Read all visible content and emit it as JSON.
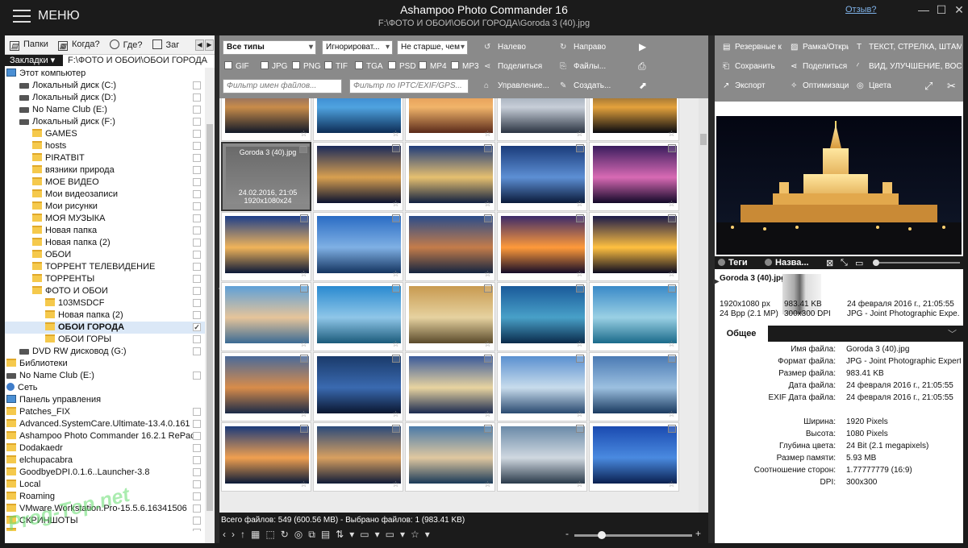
{
  "app": {
    "menu_label": "МЕНЮ",
    "title": "Ashampoo Photo Commander 16",
    "path": "F:\\ФОТО И ОБОИ\\ОБОИ ГОРОДА\\Goroda 3  (40).jpg",
    "help": "Отзыв?"
  },
  "nav": {
    "folders": "Папки",
    "when": "Когда?",
    "where": "Где?",
    "more": "Заг"
  },
  "bookmarks": {
    "label": "Закладки",
    "path": "F:\\ФОТО И ОБОИ\\ОБОИ ГОРОДА"
  },
  "tree": [
    {
      "label": "Этот компьютер",
      "indent": 1,
      "icon": "pc",
      "check": false
    },
    {
      "label": "Локальный диск (C:)",
      "indent": 2,
      "icon": "drive-icon",
      "check": true
    },
    {
      "label": "Локальный диск (D:)",
      "indent": 2,
      "icon": "drive-icon",
      "check": true
    },
    {
      "label": "No Name Club (E:)",
      "indent": 2,
      "icon": "drive-icon",
      "check": true
    },
    {
      "label": "Локальный диск (F:)",
      "indent": 2,
      "icon": "drive-icon",
      "check": true
    },
    {
      "label": "GAMES",
      "indent": 3,
      "icon": "folder-icon",
      "check": true
    },
    {
      "label": "hosts",
      "indent": 3,
      "icon": "folder-icon",
      "check": true
    },
    {
      "label": "PIRATBIT",
      "indent": 3,
      "icon": "folder-icon",
      "check": true
    },
    {
      "label": "вязники природа",
      "indent": 3,
      "icon": "folder-icon",
      "check": true
    },
    {
      "label": "МОЕ ВИДЕО",
      "indent": 3,
      "icon": "folder-icon",
      "check": true
    },
    {
      "label": "Мои видеозаписи",
      "indent": 3,
      "icon": "folder-icon",
      "check": true
    },
    {
      "label": "Мои рисунки",
      "indent": 3,
      "icon": "folder-icon",
      "check": true
    },
    {
      "label": "МОЯ МУЗЫКА",
      "indent": 3,
      "icon": "folder-icon",
      "check": true
    },
    {
      "label": "Новая папка",
      "indent": 3,
      "icon": "folder-icon",
      "check": true
    },
    {
      "label": "Новая папка (2)",
      "indent": 3,
      "icon": "folder-icon",
      "check": true
    },
    {
      "label": "ОБОИ",
      "indent": 3,
      "icon": "folder-icon",
      "check": true
    },
    {
      "label": "ТОРРЕНТ ТЕЛЕВИДЕНИЕ",
      "indent": 3,
      "icon": "folder-icon",
      "check": true
    },
    {
      "label": "ТОРРЕНТЫ",
      "indent": 3,
      "icon": "folder-icon",
      "check": true
    },
    {
      "label": "ФОТО И ОБОИ",
      "indent": 3,
      "icon": "folder-icon",
      "check": true
    },
    {
      "label": "103MSDCF",
      "indent": 4,
      "icon": "folder-icon",
      "check": true
    },
    {
      "label": "Новая папка (2)",
      "indent": 4,
      "icon": "folder-icon",
      "check": true
    },
    {
      "label": "ОБОИ ГОРОДА",
      "indent": 4,
      "icon": "folder-icon",
      "check": true,
      "checked": true,
      "selected": true
    },
    {
      "label": "ОБОИ ГОРЫ",
      "indent": 4,
      "icon": "folder-icon",
      "check": true
    },
    {
      "label": "DVD RW дисковод (G:)",
      "indent": 2,
      "icon": "drive-icon",
      "check": true
    },
    {
      "label": "Библиотеки",
      "indent": 1,
      "icon": "folder-icon",
      "check": false
    },
    {
      "label": "No Name Club (E:)",
      "indent": 1,
      "icon": "drive-icon",
      "check": true
    },
    {
      "label": "Сеть",
      "indent": 1,
      "icon": "network-icon",
      "check": false
    },
    {
      "label": "Панель управления",
      "indent": 1,
      "icon": "pc",
      "check": false
    },
    {
      "label": "Patches_FIX",
      "indent": 1,
      "icon": "folder-icon",
      "check": true
    },
    {
      "label": "Advanced.SystemCare.Ultimate-13.4.0.161",
      "indent": 1,
      "icon": "folder-icon",
      "check": true
    },
    {
      "label": "Ashampoo Photo Commander 16.2.1 RePack",
      "indent": 1,
      "icon": "folder-icon",
      "check": true
    },
    {
      "label": "Dodakaedr",
      "indent": 1,
      "icon": "folder-icon",
      "check": true
    },
    {
      "label": "elchupacabra",
      "indent": 1,
      "icon": "folder-icon",
      "check": true
    },
    {
      "label": "GoodbyeDPI.0.1.6..Launcher-3.8",
      "indent": 1,
      "icon": "folder-icon",
      "check": true
    },
    {
      "label": "Local",
      "indent": 1,
      "icon": "folder-icon",
      "check": true
    },
    {
      "label": "Roaming",
      "indent": 1,
      "icon": "folder-icon",
      "check": true
    },
    {
      "label": "VMware.Workstation.Pro-15.5.6.16341506",
      "indent": 1,
      "icon": "folder-icon",
      "check": true
    },
    {
      "label": "СКРИНШОТЫ",
      "indent": 1,
      "icon": "folder-icon",
      "check": true
    },
    {
      "label": "",
      "indent": 1,
      "icon": "folder-icon",
      "check": true
    }
  ],
  "toolbar": {
    "type_select": "Все типы",
    "ignore_select": "Игнорироват...",
    "age_select": "Не старше, чем",
    "formats": [
      "GIF",
      "JPG",
      "PNG",
      "TIF",
      "TGA",
      "PSD",
      "MP4",
      "MP3"
    ],
    "filter_name": "Фильтр имен файлов...",
    "filter_exif": "Фильтр по IPTC/EXIF/GPS...",
    "left": "Налево",
    "right": "Направо",
    "share": "Поделиться",
    "files": "Файлы...",
    "manage": "Управление...",
    "create": "Создать..."
  },
  "grid": {
    "selected_name": "Goroda 3  (40).jpg",
    "selected_date": "24.02.2016, 21:05",
    "selected_size": "1920x1080x24"
  },
  "status": {
    "text": "Всего файлов: 549 (600.56 MB) - Выбрано файлов: 1 (983.41 KB)",
    "zoom_fraction": 0.2
  },
  "right_toolbar": {
    "backup": "Резервные к",
    "frame": "Рамка/Откры",
    "text": "ТЕКСТ, СТРЕЛКА, ШТАМП,",
    "save": "Сохранить",
    "share": "Поделиться",
    "view": "ВИД, УЛУЧШЕНИЕ, ВОССТ",
    "export": "Экспорт",
    "optimize": "Оптимизация",
    "colors": "Цвета"
  },
  "preview_bar": {
    "tags": "Теги",
    "name": "Назва..."
  },
  "info": {
    "filename": "Goroda 3  (40).jpg",
    "resolution": "1920x1080 px",
    "bpp": "24 Bpp (2.1 MP)",
    "filesize": "983.41 KB",
    "dpi": "300x300 DPI",
    "date": "24 февраля 2016 г., 21:05:55",
    "format": "JPG - Joint Photographic Expe..."
  },
  "general_tab": "Общее",
  "properties": [
    {
      "k": "Имя файла:",
      "v": "Goroda 3  (40).jpg"
    },
    {
      "k": "Формат файла:",
      "v": "JPG - Joint Photographic Expert..."
    },
    {
      "k": "Размер файла:",
      "v": "983.41 KB"
    },
    {
      "k": "Дата файла:",
      "v": "24 февраля 2016 г., 21:05:55"
    },
    {
      "k": "EXIF Дата файла:",
      "v": "24 февраля 2016 г., 21:05:55"
    },
    {
      "k": "",
      "v": ""
    },
    {
      "k": "Ширина:",
      "v": "1920 Pixels"
    },
    {
      "k": "Высота:",
      "v": "1080 Pixels"
    },
    {
      "k": "Глубина цвета:",
      "v": "24 Bit (2.1 megapixels)"
    },
    {
      "k": "Размер памяти:",
      "v": "5.93 MB"
    },
    {
      "k": "Соотношение сторон:",
      "v": "1.77777779 (16:9)"
    },
    {
      "k": "DPI:",
      "v": "300x300"
    }
  ],
  "watermark": "Prog-Top.net"
}
